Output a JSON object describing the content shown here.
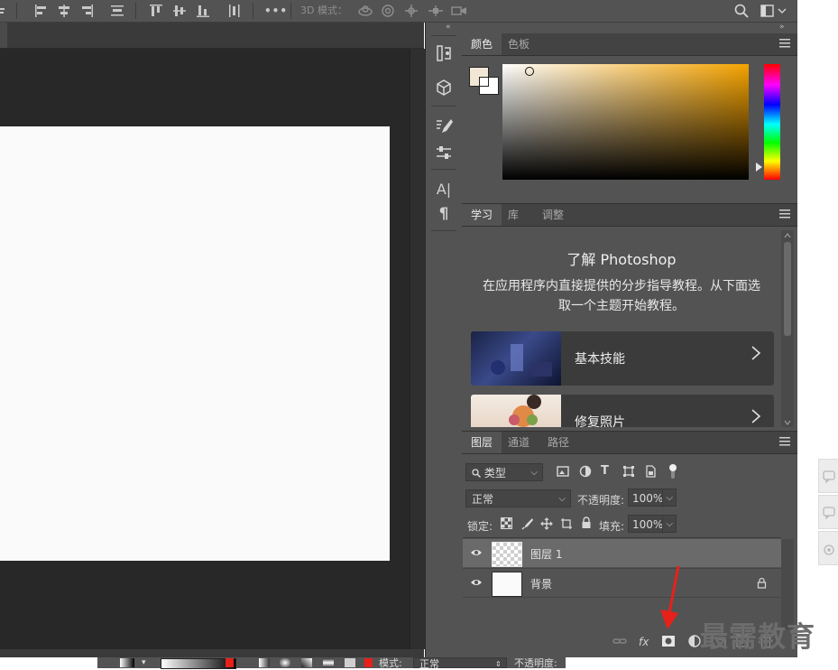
{
  "top_bar": {
    "threed_mode_label": "3D 模式：",
    "more_label": "•••",
    "icons": [
      "align-left-icon",
      "align-center-icon",
      "align-right-icon",
      "distribute-icon",
      "align-top-icon",
      "align-middle-icon",
      "align-bottom-icon",
      "distribute-vertical-icon",
      "more-icon",
      "orbit-3d-icon",
      "roll-3d-icon",
      "pan-3d-icon",
      "slide-3d-icon",
      "camera-3d-icon",
      "search-icon",
      "workspace-icon"
    ]
  },
  "tool_column": {
    "icons": [
      "history-icon",
      "3d-cube-icon",
      "brush-presets-icon",
      "properties-sliders-icon",
      "character-icon",
      "paragraph-icon"
    ],
    "character_glyph": "A|",
    "paragraph_glyph": "¶"
  },
  "color_panel": {
    "tabs": [
      "颜色",
      "色板"
    ],
    "active_tab": "颜色",
    "foreground_color": "#f2e7d4",
    "background_color": "#ffffff",
    "spectrum_hue": "#f5a300"
  },
  "learn_panel": {
    "tabs": [
      "学习",
      "库",
      "调整"
    ],
    "active_tab": "学习",
    "title": "了解 Photoshop",
    "description": "在应用程序内直接提供的分步指导教程。从下面选取一个主题开始教程。",
    "cards": [
      {
        "label": "基本技能"
      },
      {
        "label": "修复照片"
      }
    ]
  },
  "layers_panel": {
    "tabs": [
      "图层",
      "通道",
      "路径"
    ],
    "active_tab": "图层",
    "filter_type": "类型",
    "blend_mode": "正常",
    "opacity_label": "不透明度:",
    "opacity_value": "100%",
    "lock_label": "锁定:",
    "fill_label": "填充:",
    "fill_value": "100%",
    "layers": [
      {
        "name": "图层 1",
        "selected": true,
        "transparent": true
      },
      {
        "name": "背景",
        "selected": false,
        "locked": true
      }
    ],
    "footer_fx": "fx"
  },
  "bottom_bar": {
    "mode_label": "模式:",
    "mode_value": "正常",
    "opacity_label": "不透明度:"
  },
  "watermark": "最需教育",
  "colors": {
    "panel_bg": "#535353",
    "tab_bg": "#434343",
    "canvas_bg": "#282828",
    "document_bg": "#fafafa",
    "annotation_arrow": "#e8201a"
  }
}
